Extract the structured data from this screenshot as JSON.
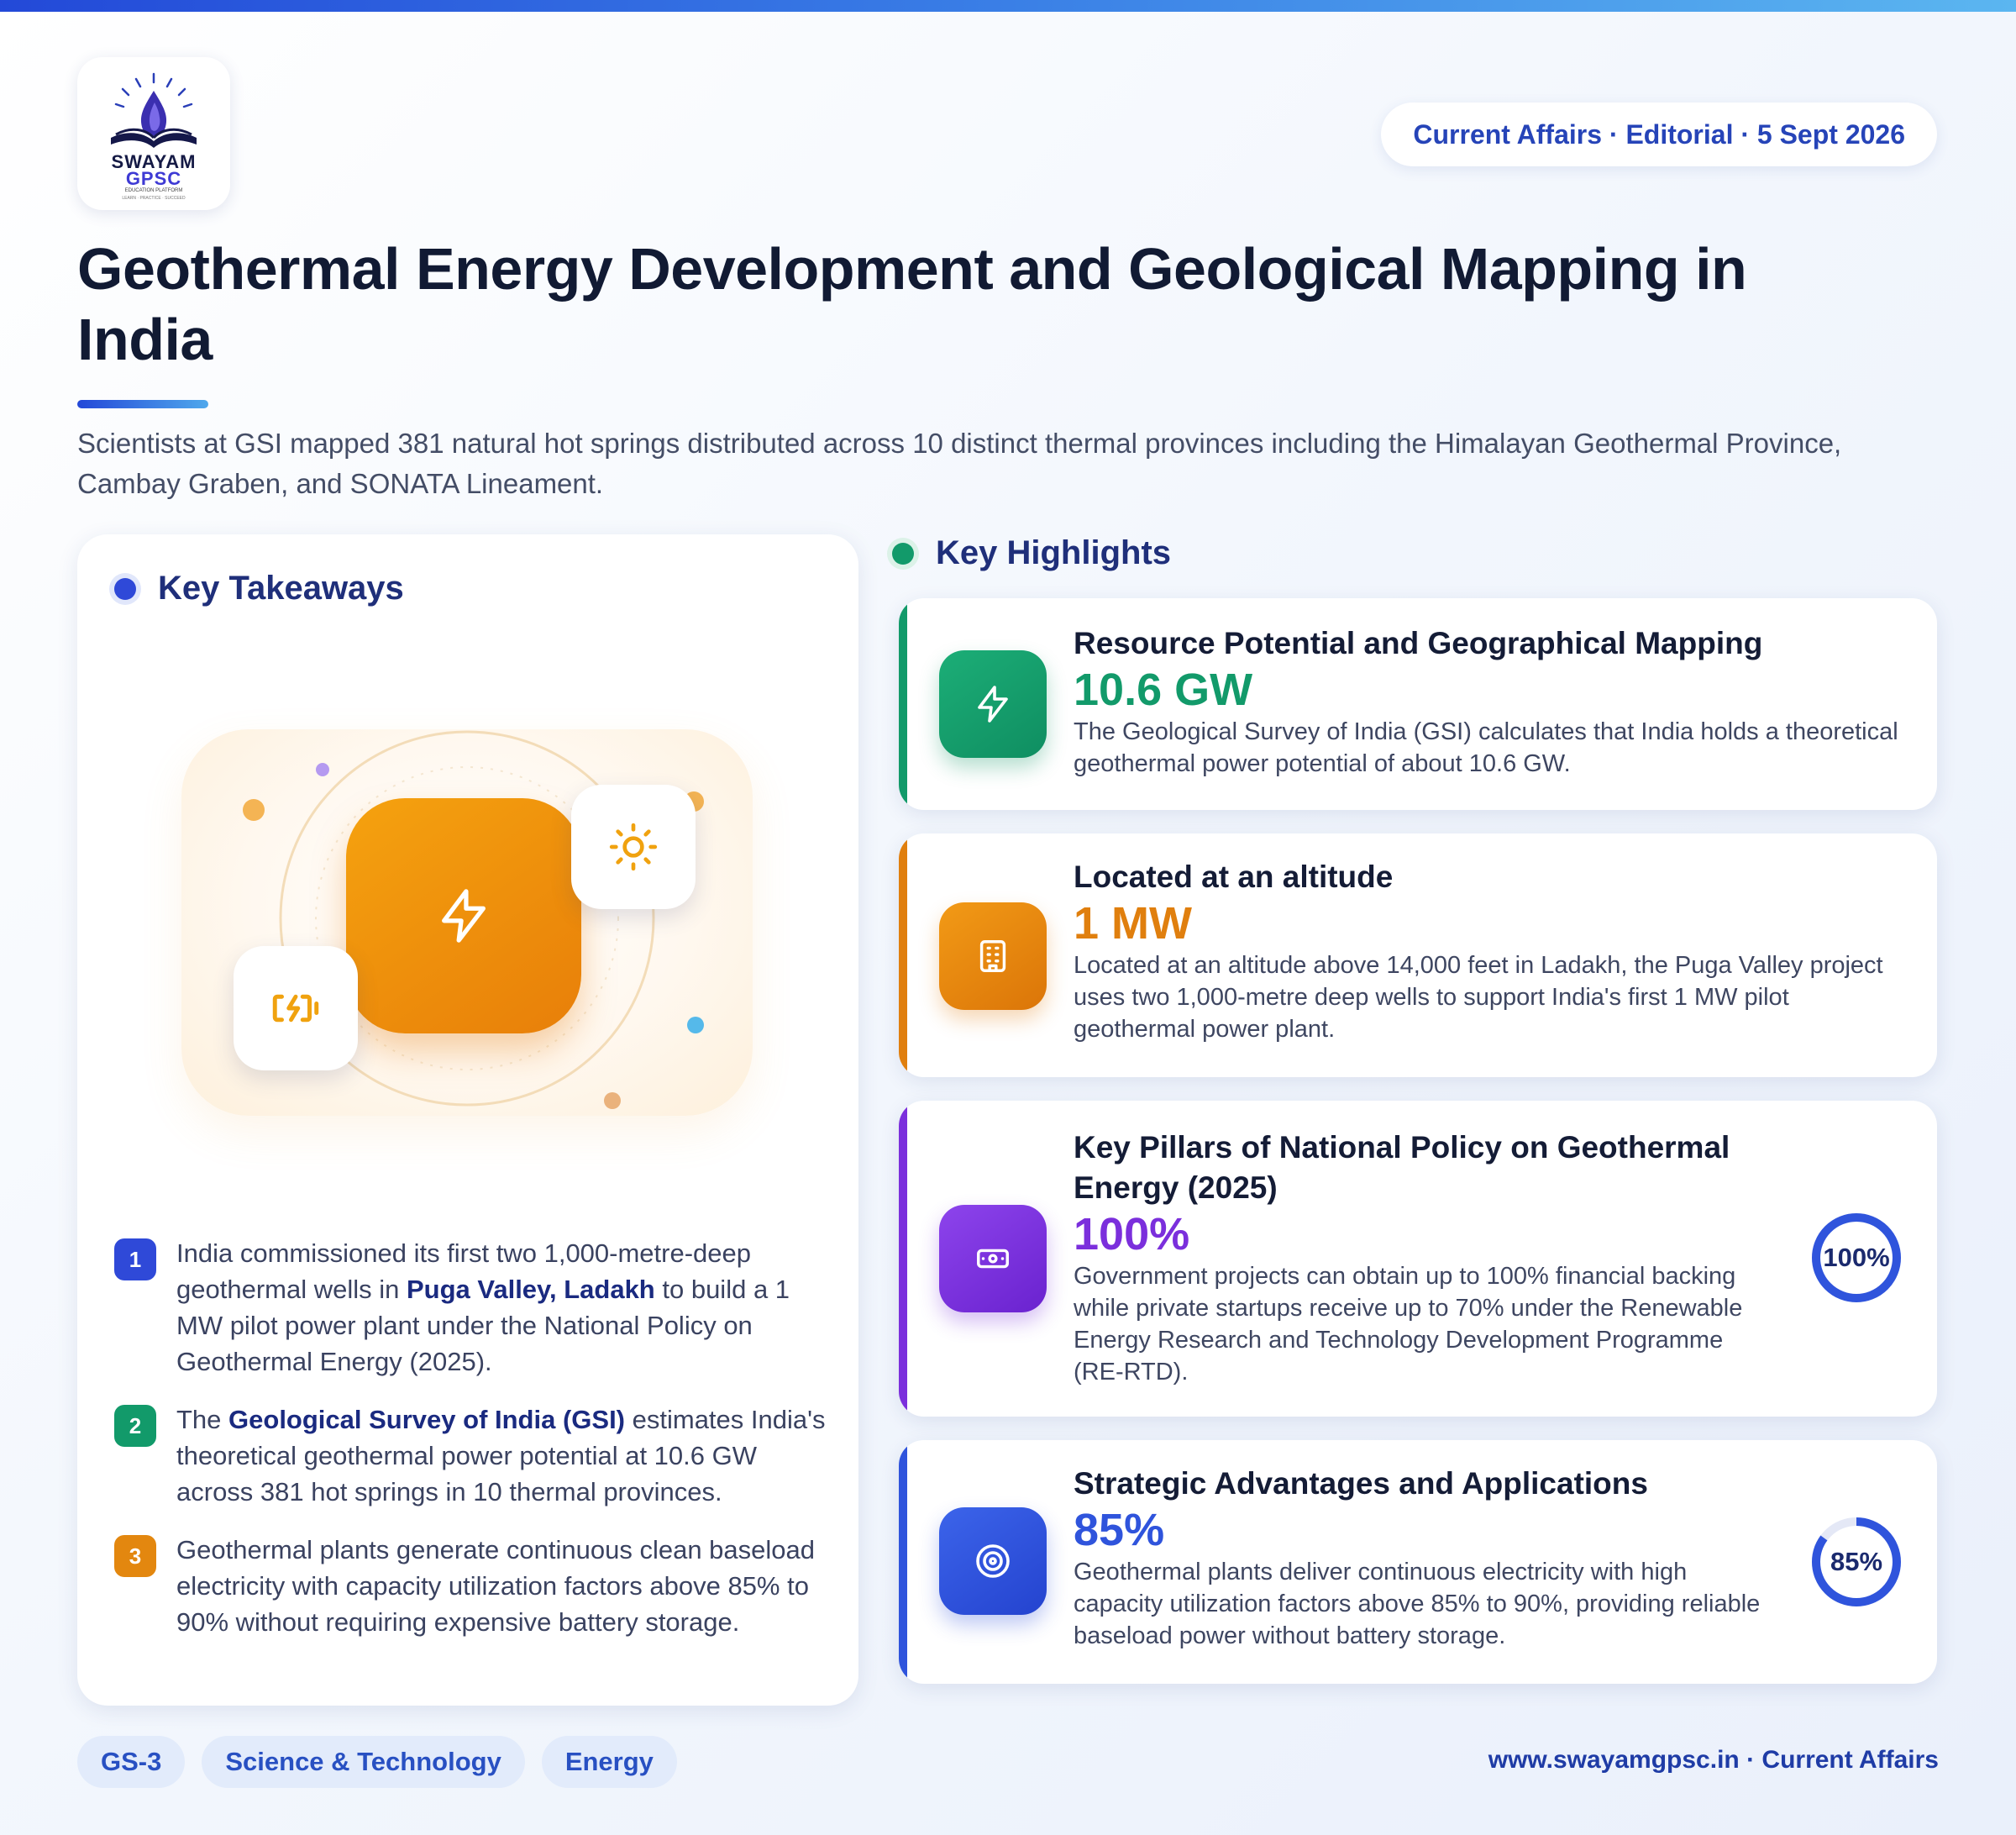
{
  "header": {
    "logo": {
      "line1": "SWAYAM",
      "line2": "GPSC",
      "line3": "EDUCATION PLATFORM",
      "line4": "LEARN · PRACTICE · SUCCEED"
    },
    "badge": "Current Affairs · Editorial · 5 Sept 2026",
    "title": "Geothermal Energy Development and Geological Mapping in India",
    "subtitle": "Scientists at GSI mapped 381 natural hot springs distributed across 10 distinct thermal provinces including the Himalayan Geothermal Province, Cambay Graben, and SONATA Lineament."
  },
  "takeaways": {
    "title": "Key Takeaways",
    "items": [
      {
        "num": "1",
        "pre": "India commissioned its first two 1,000-metre-deep geothermal wells in ",
        "bold": "Puga Valley, Ladakh",
        "post": " to build a 1 MW pilot power plant under the National Policy on Geothermal Energy (2025)."
      },
      {
        "num": "2",
        "pre": "The ",
        "bold": "Geological Survey of India (GSI)",
        "post": " estimates India's theoretical geothermal power potential at 10.6 GW across 381 hot springs in 10 thermal provinces."
      },
      {
        "num": "3",
        "pre": "Geothermal plants generate continuous clean baseload electricity with capacity utilization factors above 85% to 90% without requiring expensive battery storage.",
        "bold": "",
        "post": ""
      }
    ]
  },
  "highlights": {
    "title": "Key Highlights",
    "cards": [
      {
        "title": "Resource Potential and Geographical Mapping",
        "value": "10.6 GW",
        "desc": "The Geological Survey of India (GSI) calculates that India holds a theoretical geothermal power potential of about 10.6 GW.",
        "icon": "lightning-icon",
        "color": "#129a6a"
      },
      {
        "title": "Located at an altitude",
        "value": "1 MW",
        "desc": "Located at an altitude above 14,000 feet in Ladakh, the Puga Valley project uses two 1,000-metre deep wells to support India's first 1 MW pilot geothermal power plant.",
        "icon": "building-icon",
        "color": "#e07f0e"
      },
      {
        "title": "Key Pillars of National Policy on Geothermal Energy (2025)",
        "value": "100%",
        "desc": "Government projects can obtain up to 100% financial backing while private startups receive up to 70% under the Renewable Energy Research and Technology Development Programme (RE-RTD).",
        "icon": "cash-icon",
        "color": "#7b2fdc",
        "ring_label": "100%",
        "ring_fraction": 1.0
      },
      {
        "title": "Strategic Advantages and Applications",
        "value": "85%",
        "desc": "Geothermal plants deliver continuous electricity with high capacity utilization factors above 85% to 90%, providing reliable baseload power without battery storage.",
        "icon": "target-icon",
        "color": "#2f54dc",
        "ring_label": "85%",
        "ring_fraction": 0.85
      }
    ]
  },
  "tags": [
    "GS-3",
    "Science & Technology",
    "Energy"
  ],
  "footer": "www.swayamgpsc.in · Current Affairs"
}
